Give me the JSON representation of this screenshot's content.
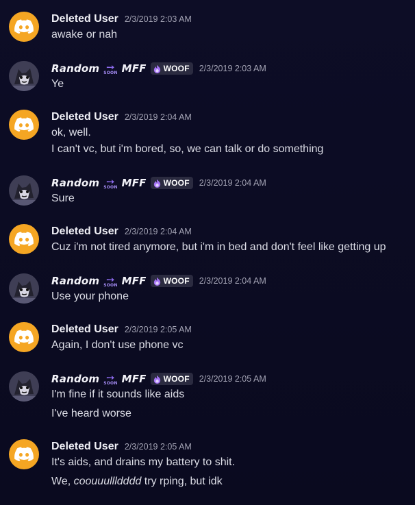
{
  "users": {
    "deleted": {
      "name": "Deleted User",
      "avatar_icon": "discord-logo-icon",
      "avatar_color": "#f5a623"
    },
    "random": {
      "name_part1": "Random",
      "soon_arrow": "➙",
      "soon_text": "SOON",
      "name_part2": "MFF",
      "tag_icon": "purple-flame-icon",
      "tag_label": "WOOF",
      "accent_color": "#8e6cf0"
    }
  },
  "messages": [
    {
      "author": "deleted",
      "timestamp": "2/3/2019 2:03 AM",
      "lines": [
        "awake or nah"
      ]
    },
    {
      "author": "random",
      "timestamp": "2/3/2019 2:03 AM",
      "lines": [
        "Ye"
      ]
    },
    {
      "author": "deleted",
      "timestamp": "2/3/2019 2:04 AM",
      "lines": [
        "ok, well.",
        "I can't vc, but i'm bored, so, we can talk or do something"
      ]
    },
    {
      "author": "random",
      "timestamp": "2/3/2019 2:04 AM",
      "lines": [
        "Sure"
      ]
    },
    {
      "author": "deleted",
      "timestamp": "2/3/2019 2:04 AM",
      "lines": [
        "Cuz i'm not tired anymore, but i'm in bed and don't feel like getting up"
      ]
    },
    {
      "author": "random",
      "timestamp": "2/3/2019 2:04 AM",
      "lines": [
        "Use your phone"
      ]
    },
    {
      "author": "deleted",
      "timestamp": "2/3/2019 2:05 AM",
      "lines": [
        "Again, I don't use phone vc"
      ]
    },
    {
      "author": "random",
      "timestamp": "2/3/2019 2:05 AM",
      "lines": [
        "I'm fine if it sounds like aids",
        "I've heard worse"
      ]
    },
    {
      "author": "deleted",
      "timestamp": "2/3/2019 2:05 AM",
      "lines": [
        "It's aids, and drains my battery to shit."
      ],
      "styled_line": {
        "prefix": "We, ",
        "italic": "coouuullldddd",
        "suffix": " try rping, but idk"
      }
    }
  ]
}
